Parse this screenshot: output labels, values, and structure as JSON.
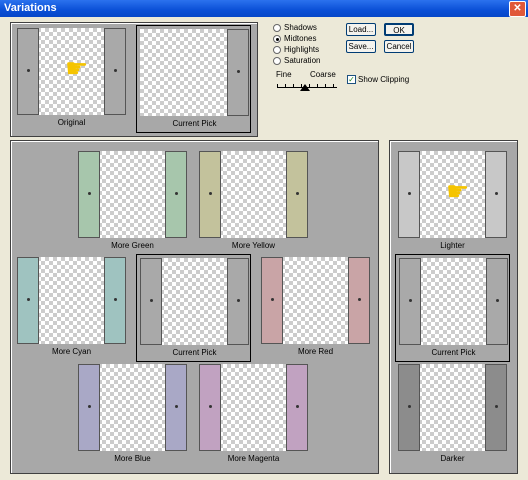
{
  "window": {
    "title": "Variations",
    "close_label": "✕"
  },
  "top": {
    "original_label": "Original",
    "current_pick_label": "Current Pick"
  },
  "controls": {
    "radios": [
      {
        "label": "Shadows",
        "selected": false
      },
      {
        "label": "Midtones",
        "selected": true
      },
      {
        "label": "Highlights",
        "selected": false
      },
      {
        "label": "Saturation",
        "selected": false
      }
    ],
    "fine_label": "Fine",
    "coarse_label": "Coarse",
    "buttons": {
      "load": "Load...",
      "ok": "OK",
      "save": "Save...",
      "cancel": "Cancel"
    },
    "show_clipping": {
      "label": "Show Clipping",
      "checked": true
    }
  },
  "color_variations": {
    "more_green": "More Green",
    "more_yellow": "More Yellow",
    "more_cyan": "More Cyan",
    "current_pick": "Current Pick",
    "more_red": "More Red",
    "more_blue": "More Blue",
    "more_magenta": "More Magenta"
  },
  "brightness": {
    "lighter": "Lighter",
    "current_pick": "Current Pick",
    "darker": "Darker"
  },
  "colors": {
    "gray": "#a9a9a9",
    "green": "#a7c6ac",
    "yellow": "#c3c29c",
    "cyan": "#9fc3c0",
    "red": "#c9a4a6",
    "blue": "#a9a8c6",
    "magenta": "#c1a2c1",
    "light": "#c8c8c8",
    "dark": "#8c8c8c"
  }
}
